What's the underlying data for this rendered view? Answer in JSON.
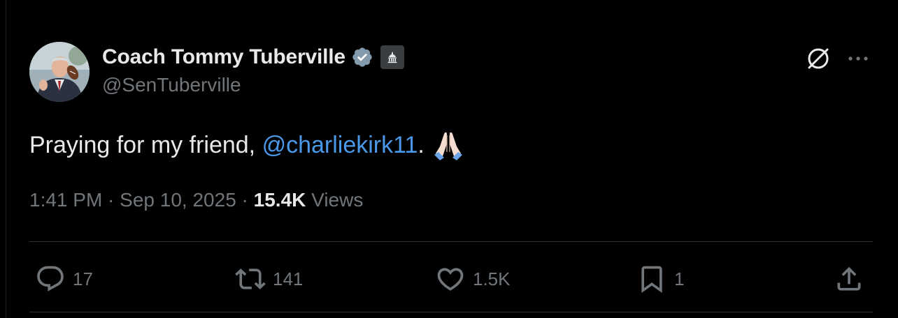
{
  "author": {
    "display_name": "Coach Tommy Tuberville",
    "handle": "@SenTuberville",
    "verified_badge_icon": "verified-check-icon",
    "affiliation_badge_icon": "government-building-icon"
  },
  "tweet": {
    "text_before": "Praying for my friend, ",
    "mention": "@charliekirk11",
    "text_after": ".",
    "emoji": "🙏🏻"
  },
  "meta": {
    "time": "1:41 PM",
    "sep1": " · ",
    "date": "Sep 10, 2025",
    "sep2": " · ",
    "views_count": "15.4K",
    "views_label": " Views"
  },
  "actions": {
    "reply_count": "17",
    "repost_count": "141",
    "like_count": "1.5K",
    "bookmark_count": "1"
  },
  "icons": {
    "top_right": [
      "grok-icon",
      "more-icon"
    ],
    "actions": [
      "reply-icon",
      "repost-icon",
      "like-icon",
      "bookmark-icon",
      "share-icon"
    ]
  },
  "colors": {
    "background": "#000000",
    "primary_text": "#e7e9ea",
    "secondary_text": "#71767b",
    "mention": "#4a99e9",
    "divider": "#2f3336",
    "verified": "#829aab"
  }
}
